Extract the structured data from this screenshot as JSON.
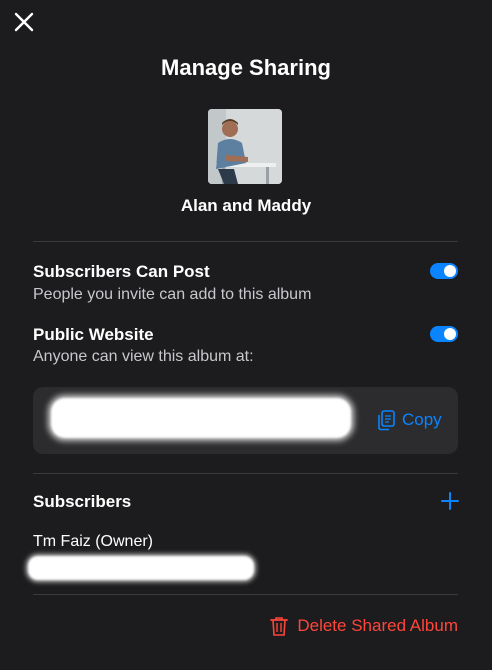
{
  "dialog": {
    "title": "Manage Sharing"
  },
  "album": {
    "name": "Alan and Maddy"
  },
  "settings": {
    "subscribers_can_post": {
      "title": "Subscribers Can Post",
      "description": "People you invite can add to this album",
      "enabled": true
    },
    "public_website": {
      "title": "Public Website",
      "description": "Anyone can view this album at:",
      "enabled": true,
      "copy_label": "Copy"
    }
  },
  "subscribers": {
    "heading": "Subscribers",
    "owner": {
      "name": "Tm Faiz (Owner)"
    }
  },
  "actions": {
    "delete_label": "Delete Shared Album"
  },
  "colors": {
    "background": "#1c1c1e",
    "accent": "#0a84ff",
    "danger": "#ff453a"
  }
}
